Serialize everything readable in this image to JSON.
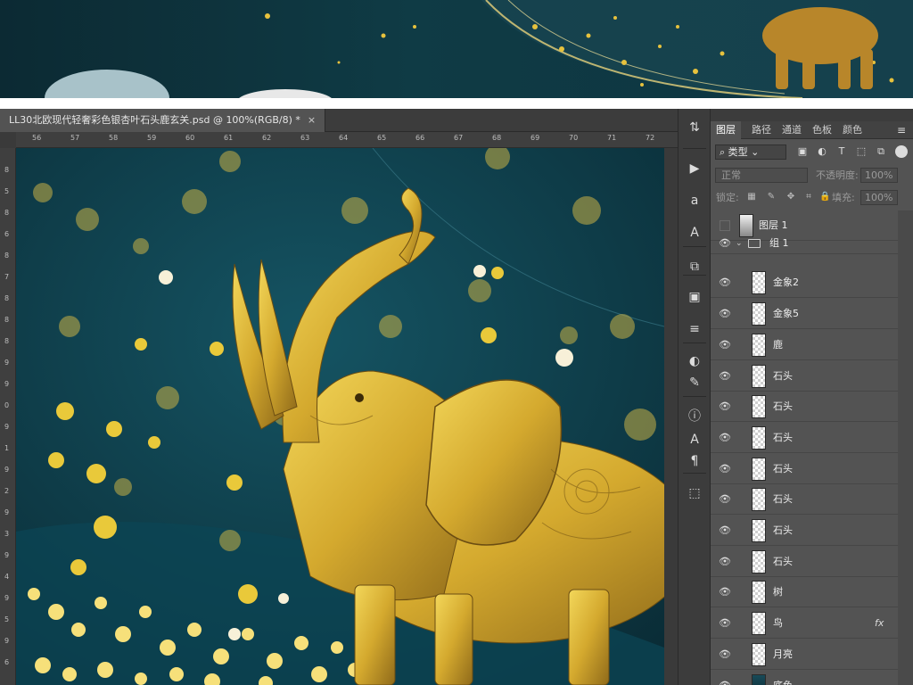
{
  "document": {
    "tab_title": "LL30北欧现代轻奢彩色银杏叶石头鹿玄关.psd @ 100%(RGB/8) *",
    "close_glyph": "×"
  },
  "rulers": {
    "top": [
      "56",
      "57",
      "58",
      "59",
      "60",
      "61",
      "62",
      "63",
      "64",
      "65",
      "66",
      "67",
      "68",
      "69",
      "70",
      "71",
      "72"
    ],
    "left": [
      "8",
      "5",
      "8",
      "6",
      "8",
      "7",
      "8",
      "8",
      "8",
      "9",
      "9",
      "0",
      "9",
      "1",
      "9",
      "2",
      "9",
      "3",
      "9",
      "4",
      "9",
      "5",
      "9",
      "6"
    ]
  },
  "tools": [
    {
      "icon": "history-brush-icon",
      "glyph": "⇅"
    },
    {
      "icon": "play-icon",
      "glyph": "▶"
    },
    {
      "icon": "character-style-icon",
      "glyph": "a"
    },
    {
      "icon": "type-tool-icon",
      "glyph": "A"
    },
    {
      "icon": "clone-source-icon",
      "glyph": "⧉"
    },
    {
      "icon": "properties-icon",
      "glyph": "▣"
    },
    {
      "icon": "adjustments-icon",
      "glyph": "≡"
    },
    {
      "icon": "color-circle-icon",
      "glyph": "◐"
    },
    {
      "icon": "brush-settings-icon",
      "glyph": "✎"
    },
    {
      "icon": "info-icon",
      "glyph": "ⓘ"
    },
    {
      "icon": "type-icon",
      "glyph": "A"
    },
    {
      "icon": "paragraph-icon",
      "glyph": "¶"
    },
    {
      "icon": "3d-icon",
      "glyph": "⬚"
    }
  ],
  "panel": {
    "tabs": [
      "图层",
      "路径",
      "通道",
      "色板",
      "颜色"
    ],
    "menu_glyph": "≡",
    "filter_value": "类型",
    "blend_mode": "正常",
    "opacity_label": "不透明度:",
    "opacity_value": "100%",
    "lock_label": "锁定:",
    "fill_label": "填充:",
    "fill_value": "100%",
    "layers": [
      {
        "name": "图层 1",
        "visible": false,
        "thumb": "image"
      },
      {
        "name": "组 1",
        "visible": true,
        "group": true
      },
      {
        "name": "金象2",
        "visible": true
      },
      {
        "name": "金象5",
        "visible": true
      },
      {
        "name": "鹿",
        "visible": true
      },
      {
        "name": "石头",
        "visible": true
      },
      {
        "name": "石头",
        "visible": true
      },
      {
        "name": "石头",
        "visible": true
      },
      {
        "name": "石头",
        "visible": true
      },
      {
        "name": "石头",
        "visible": true
      },
      {
        "name": "石头",
        "visible": true
      },
      {
        "name": "石头",
        "visible": true
      },
      {
        "name": "树",
        "visible": true
      },
      {
        "name": "鸟",
        "visible": true,
        "fx": "fx"
      },
      {
        "name": "月亮",
        "visible": true
      },
      {
        "name": "底色",
        "visible": true,
        "thumb": "dark"
      }
    ]
  },
  "colors": {
    "canvas_bg": "#0e3a45",
    "gold": "#d9b23a",
    "panel_bg": "#535353"
  }
}
